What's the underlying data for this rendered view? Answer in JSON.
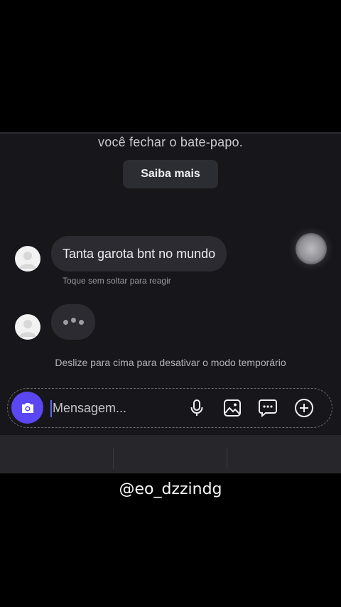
{
  "chat": {
    "notice_text": "você fechar o bate-papo.",
    "learn_more_label": "Saiba mais",
    "message": {
      "text": "Tanta garota bnt no mundo",
      "hint": "Toque sem soltar para reagir"
    },
    "swipe_hint": "Deslize para cima para desativar o modo temporário"
  },
  "composer": {
    "placeholder": "Mensagem...",
    "icons": [
      "camera-icon",
      "microphone-icon",
      "gallery-icon",
      "sticker-icon",
      "plus-icon"
    ],
    "accent_color": "#5b47f2"
  },
  "watermark": "@eo_dzzindg"
}
